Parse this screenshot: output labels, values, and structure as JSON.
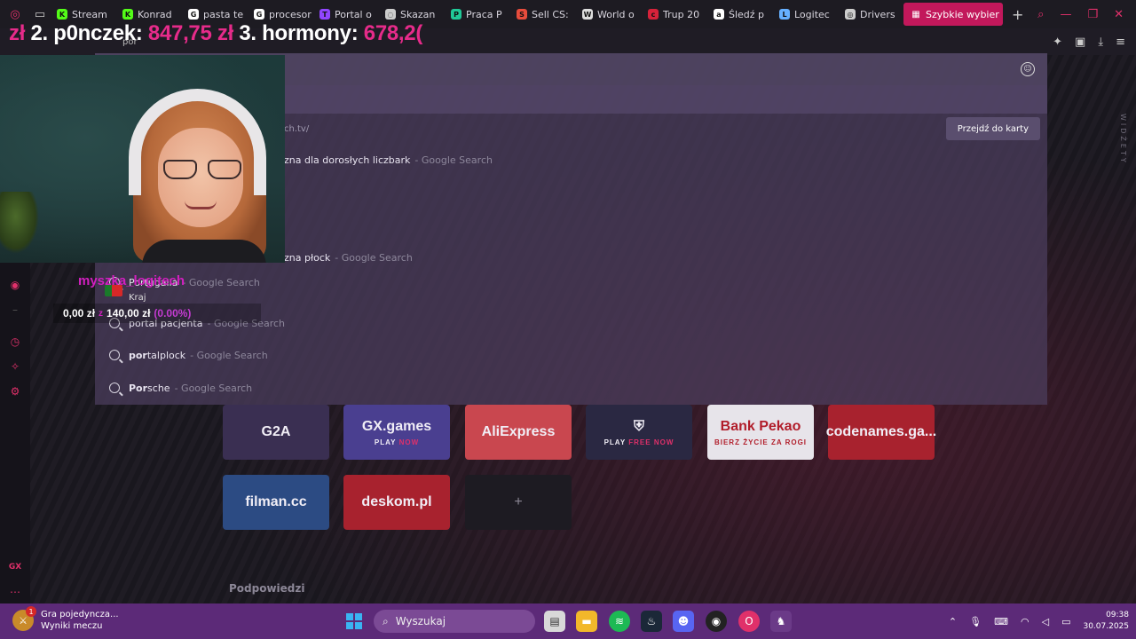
{
  "tabs": [
    {
      "label": "Stream",
      "fav_color": "#53fc18",
      "fav_text": "K"
    },
    {
      "label": "Konrad",
      "fav_color": "#53fc18",
      "fav_text": "K"
    },
    {
      "label": "pasta te",
      "fav_color": "#ffffff",
      "fav_text": "G"
    },
    {
      "label": "procesor",
      "fav_color": "#ffffff",
      "fav_text": "G"
    },
    {
      "label": "Portal o",
      "fav_color": "#9146ff",
      "fav_text": "T"
    },
    {
      "label": "Skazan",
      "fav_color": "#cccccc",
      "fav_text": "◌"
    },
    {
      "label": "Praca P",
      "fav_color": "#20c997",
      "fav_text": "P"
    },
    {
      "label": "Sell CS:",
      "fav_color": "#e74c3c",
      "fav_text": "S"
    },
    {
      "label": "World o",
      "fav_color": "#dddddd",
      "fav_text": "W"
    },
    {
      "label": "Trup 20",
      "fav_color": "#d6223a",
      "fav_text": "c"
    },
    {
      "label": "Śledź p",
      "fav_color": "#ffffff",
      "fav_text": "a"
    },
    {
      "label": "Logitec",
      "fav_color": "#66b0ff",
      "fav_text": "L"
    },
    {
      "label": "Drivers",
      "fav_color": "#cccccc",
      "fav_text": "◎"
    }
  ],
  "active_tab": {
    "label": "Szybkie wybier"
  },
  "ticker": {
    "prefix": "zł",
    "item2_label": "2. p0nczek:",
    "item2_value": "847,75 zł",
    "item3_label": "3. hormony:",
    "item3_value": "678,2("
  },
  "address_hint": "por",
  "dropdown": {
    "url_hint": "ch.tv/",
    "switch_button": "Przejdź do karty",
    "suggestions": [
      {
        "bold": "",
        "text": "zna dla dorosłych liczbark",
        "source": "Google Search"
      },
      {
        "bold": "",
        "text": "zna płock",
        "source": "Google Search"
      },
      {
        "bold": "",
        "text": "Portugalia",
        "source": "Google Search"
      },
      {
        "bold": "",
        "text": "portal pacjenta",
        "source": "Google Search"
      },
      {
        "bold": "por",
        "text": "talplock",
        "source": "Google Search"
      },
      {
        "bold": "Por",
        "text": "sche",
        "source": "Google Search"
      }
    ]
  },
  "stats": {
    "name": "myszka_logitech",
    "country_label": "Kraj",
    "amount": "0,00 zł",
    "sep": "z",
    "goal": "140,00 zł",
    "percent": "(0.00%)"
  },
  "speed_dial": {
    "tiles": [
      {
        "label": "G2A",
        "sub": "",
        "color": "#3a2f52"
      },
      {
        "label": "GX.games",
        "sub": "PLAY NOW",
        "color": "#4a3f90"
      },
      {
        "label": "AliExpress",
        "sub": "",
        "color": "#c9474f"
      },
      {
        "label": "⛨",
        "sub": "PLAY FREE NOW",
        "color": "#2a2842"
      },
      {
        "label": "Bank Pekao",
        "sub": "BIERZ ŻYCIE ZA ROGI",
        "color": "#e7e4ea"
      },
      {
        "label": "codenames.ga...",
        "sub": "",
        "color": "#a8222e"
      },
      {
        "label": "filman.cc",
        "sub": "",
        "color": "#2c4b83"
      },
      {
        "label": "deskom.pl",
        "sub": "",
        "color": "#a8222e"
      },
      {
        "label": "+",
        "sub": "",
        "color": "#1d1b22"
      }
    ],
    "hints_label": "Podpowiedzi",
    "widgets_label": "WIDŻETY"
  },
  "taskbar": {
    "notification_title": "Gra pojedyncza...",
    "notification_sub": "Wyniki meczu",
    "notification_badge": "1",
    "search_placeholder": "Wyszukaj",
    "time": "09:38",
    "date": "30.07.2025"
  },
  "colors": {
    "accent": "#e0306a",
    "taskbar": "#5c2a78",
    "active_tab": "#c2185b"
  }
}
